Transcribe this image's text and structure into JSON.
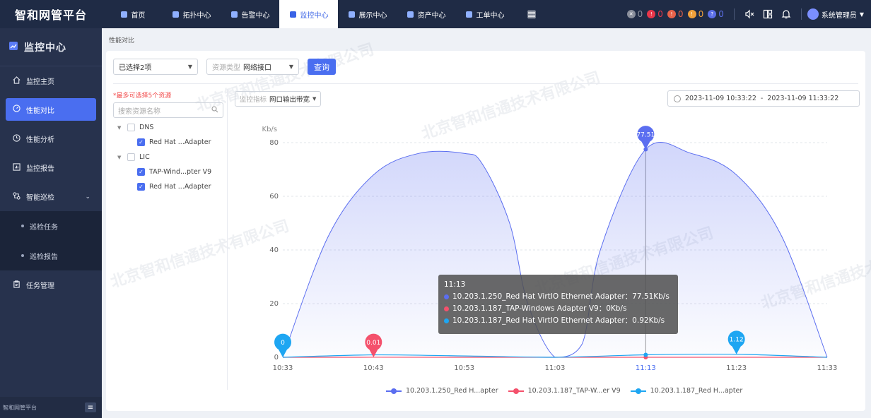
{
  "app": {
    "title": "智和网管平台",
    "footer_title": "智和网管平台"
  },
  "topnav": {
    "items": [
      {
        "label": "首页"
      },
      {
        "label": "拓扑中心"
      },
      {
        "label": "告警中心"
      },
      {
        "label": "监控中心"
      },
      {
        "label": "展示中心"
      },
      {
        "label": "资产中心"
      },
      {
        "label": "工单中心"
      }
    ],
    "active_index": 3
  },
  "alarms": [
    {
      "count": "0",
      "color": "#8a8f9c",
      "glyph": "✕"
    },
    {
      "count": "0",
      "color": "#e8364a",
      "glyph": "!"
    },
    {
      "count": "0",
      "color": "#e8624a",
      "glyph": "!"
    },
    {
      "count": "0",
      "color": "#f1a13a",
      "glyph": "!"
    },
    {
      "count": "0",
      "color": "#5b6ee8",
      "glyph": "?"
    }
  ],
  "user": {
    "name": "系统管理员"
  },
  "sidebar": {
    "header": "监控中心",
    "items": [
      {
        "label": "监控主页"
      },
      {
        "label": "性能对比"
      },
      {
        "label": "性能分析"
      },
      {
        "label": "监控报告"
      },
      {
        "label": "智能巡检"
      },
      {
        "label": "任务管理"
      }
    ],
    "subitems": [
      {
        "label": "巡检任务"
      },
      {
        "label": "巡检报告"
      }
    ]
  },
  "breadcrumb": "性能对比",
  "toolbar": {
    "selected": "已选择2项",
    "resource_type_label": "资源类型",
    "resource_type_value": "网络接口",
    "query_label": "查询"
  },
  "resources": {
    "warning": "*最多可选择5个资源",
    "search_placeholder": "搜索资源名称",
    "groups": [
      {
        "name": "DNS",
        "children": [
          {
            "name": "Red Hat ...Adapter",
            "checked": true
          }
        ]
      },
      {
        "name": "LIC",
        "children": [
          {
            "name": "TAP-Wind...pter V9",
            "checked": true
          },
          {
            "name": "Red Hat ...Adapter",
            "checked": true
          }
        ]
      }
    ]
  },
  "metric": {
    "label": "监控指标",
    "value": "网口输出带宽"
  },
  "daterange": {
    "start": "2023-11-09 10:33:22",
    "sep": "-",
    "end": "2023-11-09 11:33:22"
  },
  "tooltip": {
    "time": "11:13",
    "rows": [
      {
        "text": "10.203.1.250_Red Hat VirtIO Ethernet Adapter：77.51Kb/s",
        "color": "#5b6ef0"
      },
      {
        "text": "10.203.1.187_TAP-Windows Adapter V9：0Kb/s",
        "color": "#f4516c"
      },
      {
        "text": "10.203.1.187_Red Hat VirtIO Ethernet Adapter：0.92Kb/s",
        "color": "#1ea6f2"
      }
    ]
  },
  "legend": [
    {
      "label": "10.203.1.250_Red H...apter",
      "color": "#5b6ef0"
    },
    {
      "label": "10.203.1.187_TAP-W...er V9",
      "color": "#f4516c"
    },
    {
      "label": "10.203.1.187_Red H...apter",
      "color": "#1ea6f2"
    }
  ],
  "watermark": "北京智和信通技术有限公司",
  "chart_data": {
    "type": "area",
    "ylabel": "Kb/s",
    "ylim": [
      0,
      80
    ],
    "yticks": [
      0,
      20,
      40,
      60,
      80
    ],
    "x_ticks": [
      "10:33",
      "10:43",
      "10:53",
      "11:03",
      "11:13",
      "11:23",
      "11:33"
    ],
    "highlight_x": "11:13",
    "grid": true,
    "legend_position": "bottom",
    "series": [
      {
        "name": "10.203.1.250_Red H...apter",
        "color": "#5b6ef0",
        "x": [
          "10:33",
          "10:38",
          "10:43",
          "10:48",
          "10:53",
          "10:55",
          "10:58",
          "11:00",
          "11:03",
          "11:06",
          "11:08",
          "11:13",
          "11:18",
          "11:23",
          "11:28",
          "11:33"
        ],
        "values": [
          0,
          45,
          68,
          76,
          76,
          72,
          50,
          20,
          0,
          5,
          40,
          77.51,
          76,
          68,
          45,
          0
        ]
      },
      {
        "name": "10.203.1.187_TAP-W...er V9",
        "color": "#f4516c",
        "x": [
          "10:33",
          "10:43",
          "10:53",
          "11:03",
          "11:13",
          "11:23",
          "11:33"
        ],
        "values": [
          0,
          0.01,
          0,
          0,
          0,
          0,
          0
        ]
      },
      {
        "name": "10.203.1.187_Red H...apter",
        "color": "#1ea6f2",
        "x": [
          "10:33",
          "10:43",
          "10:53",
          "11:03",
          "11:13",
          "11:23",
          "11:33"
        ],
        "values": [
          0,
          0.9,
          0.5,
          0,
          0.92,
          1.12,
          0
        ]
      }
    ],
    "markers": [
      {
        "series": 0,
        "x": "11:13",
        "label": "77.51"
      },
      {
        "series": 1,
        "x": "10:43",
        "label": "0.01"
      },
      {
        "series": 2,
        "x": "10:33",
        "label": "0"
      },
      {
        "series": 2,
        "x": "11:23",
        "label": "1.12"
      }
    ]
  }
}
